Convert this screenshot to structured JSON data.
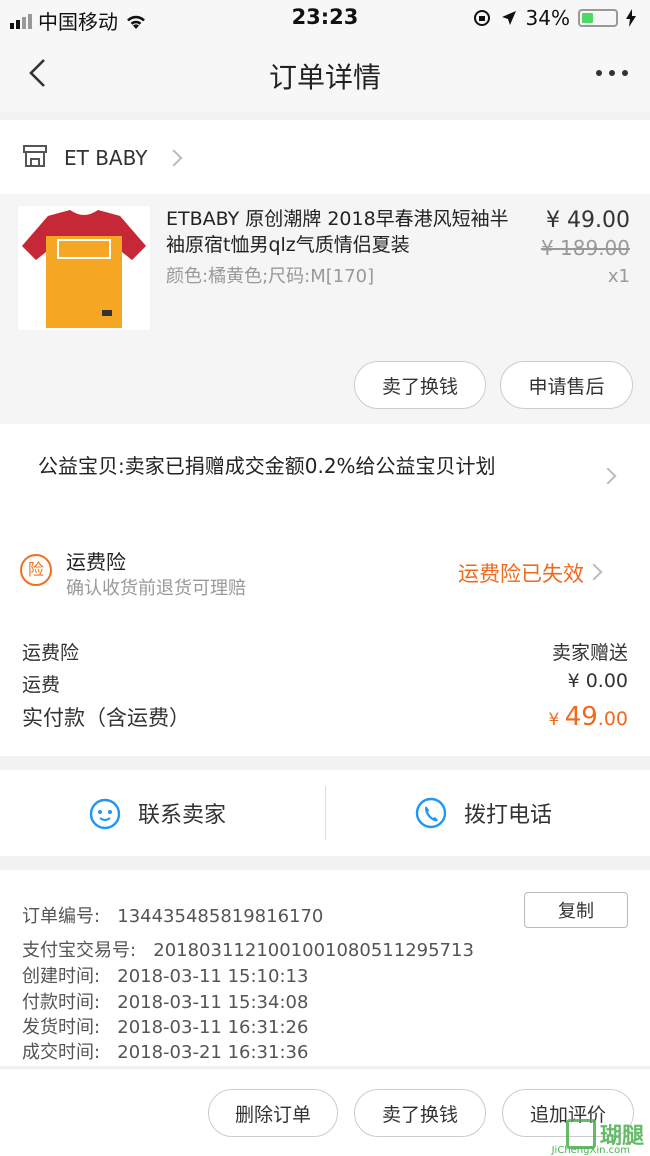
{
  "status_bar": {
    "carrier": "中国移动",
    "time": "23:23",
    "battery": "34%",
    "battery_level": 0.34
  },
  "nav": {
    "title": "订单详情"
  },
  "shop": {
    "name": "ET BABY"
  },
  "item": {
    "title": "ETBABY 原创潮牌 2018早春港风短袖半袖原宿t恤男qlz气质情侣夏装",
    "sku": "颜色:橘黄色;尺码:M[170]",
    "price": "¥ 49.00",
    "original_price": "¥ 189.00",
    "quantity": "x1",
    "buttons": {
      "resell": "卖了换钱",
      "after_sale": "申请售后"
    }
  },
  "charity": {
    "text": "公益宝贝:卖家已捐赠成交金额0.2%给公益宝贝计划"
  },
  "insurance": {
    "icon_text": "险",
    "title": "运费险",
    "subtitle": "确认收货前退货可理赔",
    "status": "运费险已失效"
  },
  "summary": {
    "rows": [
      {
        "label": "运费险",
        "value": "卖家赠送"
      },
      {
        "label": "运费",
        "value": "¥ 0.00"
      }
    ],
    "total_label": "实付款（含运费）",
    "total_currency": "¥ ",
    "total_int": "49",
    "total_dec": ".00"
  },
  "contact": {
    "seller": "联系卖家",
    "phone": "拨打电话"
  },
  "order_info": {
    "order_no_label": "订单编号:",
    "order_no": "134435485819816170",
    "copy": "复制",
    "alipay_label": "支付宝交易号:",
    "alipay_no": "2018031121001001080511295713",
    "created_label": "创建时间:",
    "created": "2018-03-11 15:10:13",
    "paid_label": "付款时间:",
    "paid": "2018-03-11 15:34:08",
    "shipped_label": "发货时间:",
    "shipped": "2018-03-11 16:31:26",
    "done_label": "成交时间:",
    "done": "2018-03-21 16:31:36"
  },
  "footer": {
    "delete": "删除订单",
    "resell": "卖了换钱",
    "review": "追加评价"
  },
  "watermark": {
    "text": "瑚腿",
    "url": "JiChengXin.com"
  },
  "colors": {
    "accent": "#f06a1d",
    "icon_blue": "#2196f3"
  }
}
